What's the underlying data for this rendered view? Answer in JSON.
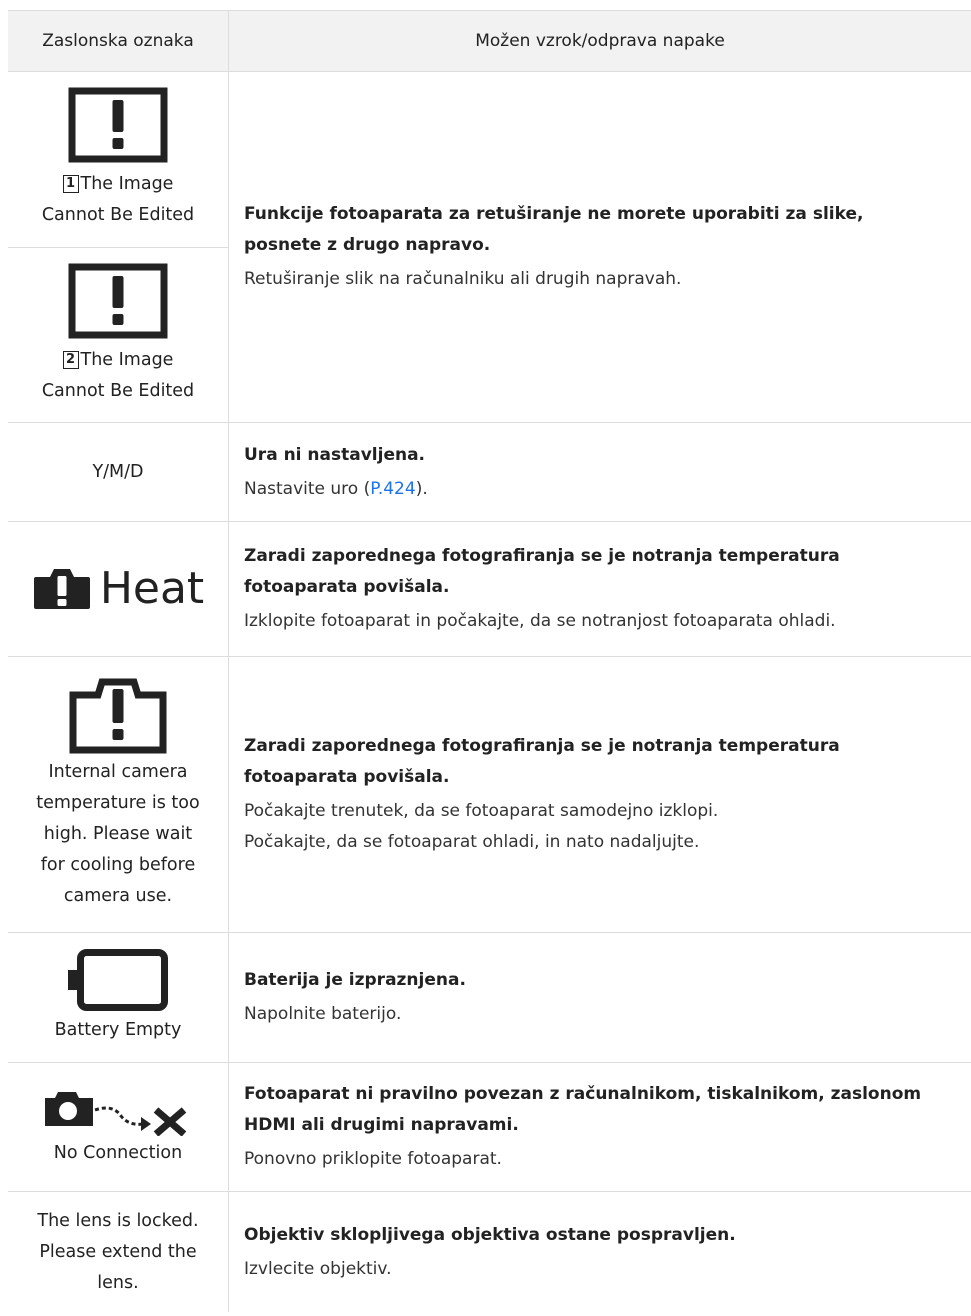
{
  "header": {
    "col1": "Zaslonska oznaka",
    "col2": "Možen vzrok/odprava napake"
  },
  "rows": {
    "edit": {
      "item1_badge": "1",
      "item1_line1": "The Image",
      "item1_line2": "Cannot Be Edited",
      "item2_badge": "2",
      "item2_line1": "The Image",
      "item2_line2": "Cannot Be Edited",
      "bold1": "Funkcije fotoaparata za retuširanje ne morete uporabiti za slike,",
      "bold2": "posnete z drugo napravo.",
      "text1": "Retuširanje slik na računalniku ali drugih napravah."
    },
    "date": {
      "label": "Y/M/D",
      "bold1": "Ura ni nastavljena.",
      "text_pre": "Nastavite uro (",
      "link": "P.424",
      "text_post": ")."
    },
    "heat": {
      "label": "Heat",
      "bold1": "Zaradi zaporednega fotografiranja se je notranja temperatura",
      "bold2": "fotoaparata povišala.",
      "text1": "Izklopite fotoaparat in počakajte, da se notranjost fotoaparata ohladi."
    },
    "internal": {
      "line1": "Internal camera",
      "line2": "temperature is too",
      "line3": "high. Please wait",
      "line4": "for cooling before",
      "line5": "camera use.",
      "bold1": "Zaradi zaporednega fotografiranja se je notranja temperatura",
      "bold2": "fotoaparata povišala.",
      "text1": "Počakajte trenutek, da se fotoaparat samodejno izklopi.",
      "text2": "Počakajte, da se fotoaparat ohladi, in nato nadaljujte."
    },
    "battery": {
      "label": "Battery Empty",
      "bold1": "Baterija je izpraznjena.",
      "text1": "Napolnite baterijo."
    },
    "connection": {
      "label": "No Connection",
      "bold1": "Fotoaparat ni pravilno povezan z računalnikom, tiskalnikom, zaslonom",
      "bold2": "HDMI ali drugimi napravami.",
      "text1": "Ponovno priklopite fotoaparat."
    },
    "lens": {
      "line1": "The lens is locked.",
      "line2": "Please extend the",
      "line3": "lens.",
      "bold1": "Objektiv sklopljivega objektiva ostane pospravljen.",
      "text1": "Izvlecite objektiv."
    }
  }
}
